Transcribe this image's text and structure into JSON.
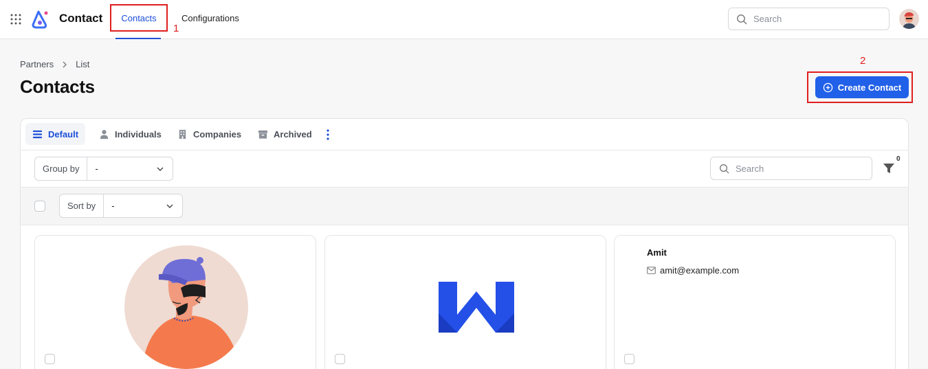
{
  "app": {
    "name": "Contact"
  },
  "nav": {
    "contacts": "Contacts",
    "configurations": "Configurations"
  },
  "annotations": {
    "marker_1": "1",
    "marker_2": "2"
  },
  "top_search": {
    "placeholder": "Search"
  },
  "breadcrumb": {
    "items": [
      "Partners",
      "List"
    ]
  },
  "page": {
    "title": "Contacts",
    "create_button": "Create Contact"
  },
  "views": {
    "tabs": [
      "Default",
      "Individuals",
      "Companies",
      "Archived"
    ],
    "active": "Default"
  },
  "filters": {
    "group_by_label": "Group by",
    "group_by_value": "-",
    "search_placeholder": "Search",
    "filter_count": "0"
  },
  "sort": {
    "label": "Sort by",
    "value": "-"
  },
  "cards": [
    {
      "type": "avatar"
    },
    {
      "type": "logo"
    },
    {
      "type": "contact",
      "name": "Amit",
      "email": "amit@example.com"
    }
  ],
  "colors": {
    "accent": "#2160e8",
    "annotation": "#e01e1e",
    "avatar_shirt": "#f47a4e",
    "cap": "#6f6ed6",
    "logo_blue": "#2450e8"
  }
}
